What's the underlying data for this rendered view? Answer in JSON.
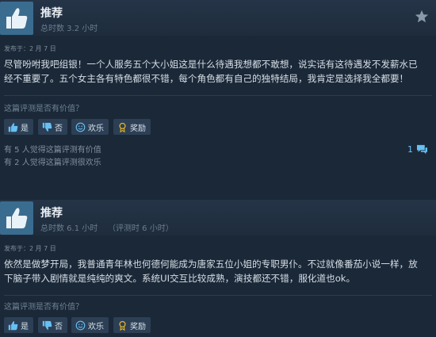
{
  "reviews": [
    {
      "recommendation": "推荐",
      "hours": "总时数 3.2 小时",
      "posted": "发布于：2 月 7 日",
      "body_line1": "尽管吩咐我吧组银！一个人服务五个大小姐这是什么待遇我想都不敢想，说实话有这待遇发不发薪水已",
      "body_line2": "经不重要了。五个女主各有特色都很不错，每个角色都有自己的独特结局，我肯定是选择我全都要！",
      "helpful_question": "这篇评测是否有价值？",
      "buttons": {
        "yes": "是",
        "no": "否",
        "funny": "欢乐",
        "award": "奖励"
      },
      "helpful_count": "有 5 人觉得这篇评测有价值",
      "funny_count": "有 2 人觉得这篇评测很欢乐",
      "comment_count": "1"
    },
    {
      "recommendation": "推荐",
      "hours": "总时数 6.1 小时    （评测时 6 小时）",
      "posted": "发布于：2 月 7 日",
      "body_line1": "依然是做梦开局，我普通青年林也何德何能成为唐家五位小姐的专职男仆。不过就像番茄小说一样，放",
      "body_line2": "下脑子带入剧情就是纯纯的爽文。系统UI交互比较成熟，演技都还不错，服化道也ok。",
      "helpful_question": "这篇评测是否有价值？",
      "buttons": {
        "yes": "是",
        "no": "否",
        "funny": "欢乐",
        "award": "奖励"
      }
    }
  ],
  "colors": {
    "background": "#1b2838",
    "header": "#253447",
    "thumb_box": "#3a6c8f",
    "button": "#2c3f55",
    "link_blue": "#66c0f4",
    "award_gold": "#e1b12c"
  },
  "icons": {
    "thumb": "thumbs-up-icon",
    "star": "star-icon",
    "yes": "thumbs-up-icon",
    "no": "thumbs-down-icon",
    "funny": "smiley-icon",
    "award": "award-icon",
    "comment": "comment-icon"
  }
}
